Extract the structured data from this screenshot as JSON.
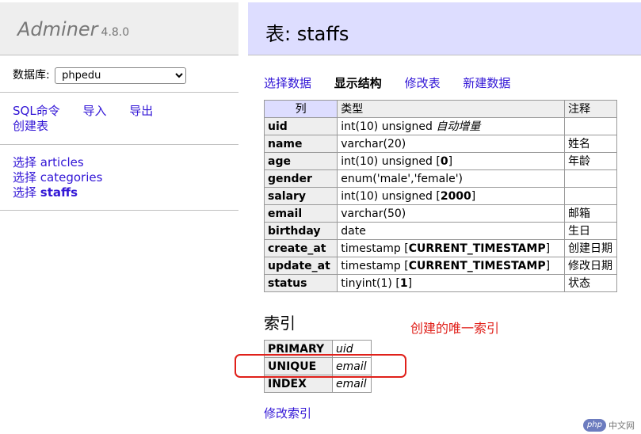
{
  "app": {
    "name": "Adminer",
    "version": "4.8.0"
  },
  "db": {
    "label": "数据库:",
    "selected": "phpedu"
  },
  "left_links": {
    "sql": "SQL命令",
    "import": "导入",
    "export": "导出",
    "create_table": "创建表"
  },
  "tables_nav": [
    {
      "prefix": "选择",
      "name": "articles"
    },
    {
      "prefix": "选择",
      "name": "categories"
    },
    {
      "prefix": "选择",
      "name": "staffs"
    }
  ],
  "page": {
    "title": "表: staffs"
  },
  "actions": {
    "select": "选择数据",
    "structure": "显示结构",
    "alter": "修改表",
    "new": "新建数据"
  },
  "structure": {
    "headers": {
      "column": "列",
      "type": "类型",
      "comment": "注释"
    },
    "rows": [
      {
        "name": "uid",
        "type": "int(10) unsigned",
        "extra": "自动增量",
        "comment": ""
      },
      {
        "name": "name",
        "type": "varchar(20)",
        "comment": "姓名"
      },
      {
        "name": "age",
        "type": "int(10) unsigned",
        "default": "0",
        "comment": "年龄"
      },
      {
        "name": "gender",
        "type": "enum('male','female')",
        "comment": ""
      },
      {
        "name": "salary",
        "type": "int(10) unsigned",
        "default": "2000",
        "comment": ""
      },
      {
        "name": "email",
        "type": "varchar(50)",
        "comment": "邮箱"
      },
      {
        "name": "birthday",
        "type": "date",
        "comment": "生日"
      },
      {
        "name": "create_at",
        "type": "timestamp",
        "default": "CURRENT_TIMESTAMP",
        "comment": "创建日期"
      },
      {
        "name": "update_at",
        "type": "timestamp",
        "default": "CURRENT_TIMESTAMP",
        "comment": "修改日期"
      },
      {
        "name": "status",
        "type": "tinyint(1)",
        "default": "1",
        "comment": "状态"
      }
    ]
  },
  "indexes": {
    "heading": "索引",
    "annotation": "创建的唯一索引",
    "rows": [
      {
        "type": "PRIMARY",
        "column": "uid"
      },
      {
        "type": "UNIQUE",
        "column": "email"
      },
      {
        "type": "INDEX",
        "column": "email"
      }
    ],
    "edit_link": "修改索引"
  },
  "watermark": {
    "logo": "php",
    "text": "中文网"
  },
  "colors": {
    "link": "#3216d6",
    "annotation": "#e0201a",
    "header_bg": "#ddddff"
  }
}
